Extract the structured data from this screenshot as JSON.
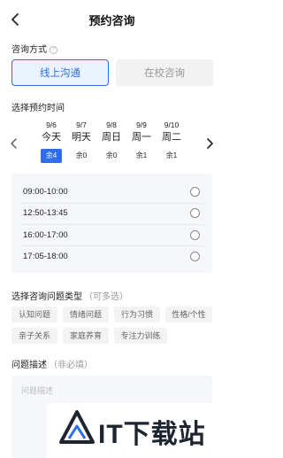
{
  "header": {
    "title": "预约咨询"
  },
  "method": {
    "label": "咨询方式",
    "options": [
      {
        "label": "线上沟通",
        "selected": true
      },
      {
        "label": "在校咨询",
        "selected": false
      }
    ]
  },
  "date": {
    "label": "选择预约时间",
    "days": [
      {
        "md": "9/6",
        "day": "今天",
        "remain": "余4",
        "selected": true
      },
      {
        "md": "9/7",
        "day": "明天",
        "remain": "余0",
        "selected": false
      },
      {
        "md": "9/8",
        "day": "周日",
        "remain": "余0",
        "selected": false
      },
      {
        "md": "9/9",
        "day": "周一",
        "remain": "余1",
        "selected": false
      },
      {
        "md": "9/10",
        "day": "周二",
        "remain": "余1",
        "selected": false
      }
    ]
  },
  "slots": [
    "09:00-10:00",
    "12:50-13:45",
    "16:00-17:00",
    "17:05-18:00"
  ],
  "issue": {
    "label": "选择咨询问题类型",
    "hint": "（可多选）",
    "tags": [
      "认知问题",
      "情绪问题",
      "行为习惯",
      "性格/个性",
      "亲子关系",
      "家庭养育",
      "专注力训练"
    ]
  },
  "desc": {
    "label": "问题描述",
    "hint": "（非必填）",
    "placeholder": "问题描述"
  },
  "watermark": {
    "text": "IT下载站"
  },
  "colors": {
    "accent": "#2f6ee8"
  }
}
